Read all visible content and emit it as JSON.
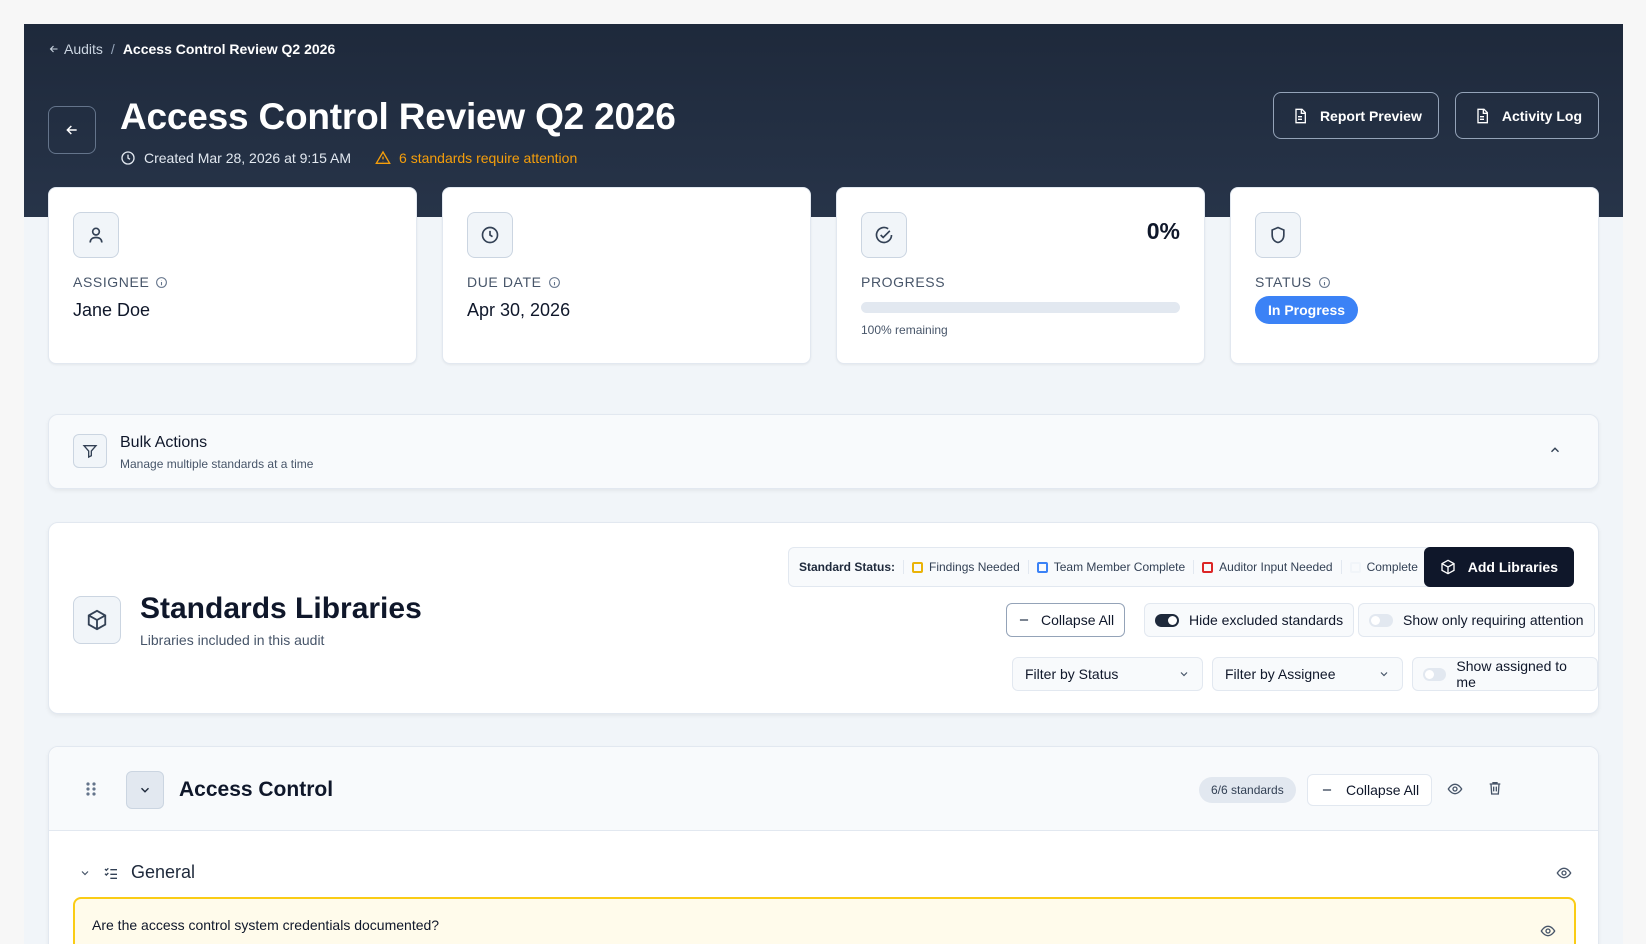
{
  "breadcrumb": {
    "back_label": "Audits",
    "separator": "/",
    "current": "Access Control Review Q2 2026"
  },
  "header": {
    "title": "Access Control Review Q2 2026",
    "created": "Created Mar 28, 2026 at 9:15 AM",
    "warning": "6 standards require attention",
    "buttons": {
      "report_preview": "Report Preview",
      "activity_log": "Activity Log"
    }
  },
  "cards": {
    "assignee": {
      "label": "ASSIGNEE",
      "value": "Jane Doe"
    },
    "due_date": {
      "label": "DUE DATE",
      "value": "Apr 30, 2026"
    },
    "progress": {
      "label": "PROGRESS",
      "percent_text": "0%",
      "percent": 0,
      "remaining": "100% remaining"
    },
    "status": {
      "label": "STATUS",
      "value": "In Progress"
    }
  },
  "bulk_actions": {
    "title": "Bulk Actions",
    "subtitle": "Manage multiple standards at a time"
  },
  "libraries": {
    "title": "Standards Libraries",
    "subtitle": "Libraries included in this audit",
    "legend": {
      "label": "Standard Status:",
      "items": [
        {
          "label": "Findings Needed",
          "color": "#eab308"
        },
        {
          "label": "Team Member Complete",
          "color": "#3b82f6"
        },
        {
          "label": "Auditor Input Needed",
          "color": "#dc2626"
        },
        {
          "label": "Complete",
          "color": "#f1f5f9"
        }
      ]
    },
    "add_button": "Add Libraries",
    "collapse_all": "Collapse All",
    "hide_excluded": "Hide excluded standards",
    "show_requiring": "Show only requiring attention",
    "filter_status": "Filter by Status",
    "filter_assignee": "Filter by Assignee",
    "show_assigned": "Show assigned to me"
  },
  "library_section": {
    "title": "Access Control",
    "count": "6/6 standards",
    "collapse_all": "Collapse All",
    "group": "General",
    "question": "Are the access control system credentials documented?"
  },
  "colors": {
    "hero": "#1e293b",
    "accent": "#3b82f6",
    "warning": "#f59e0b"
  }
}
